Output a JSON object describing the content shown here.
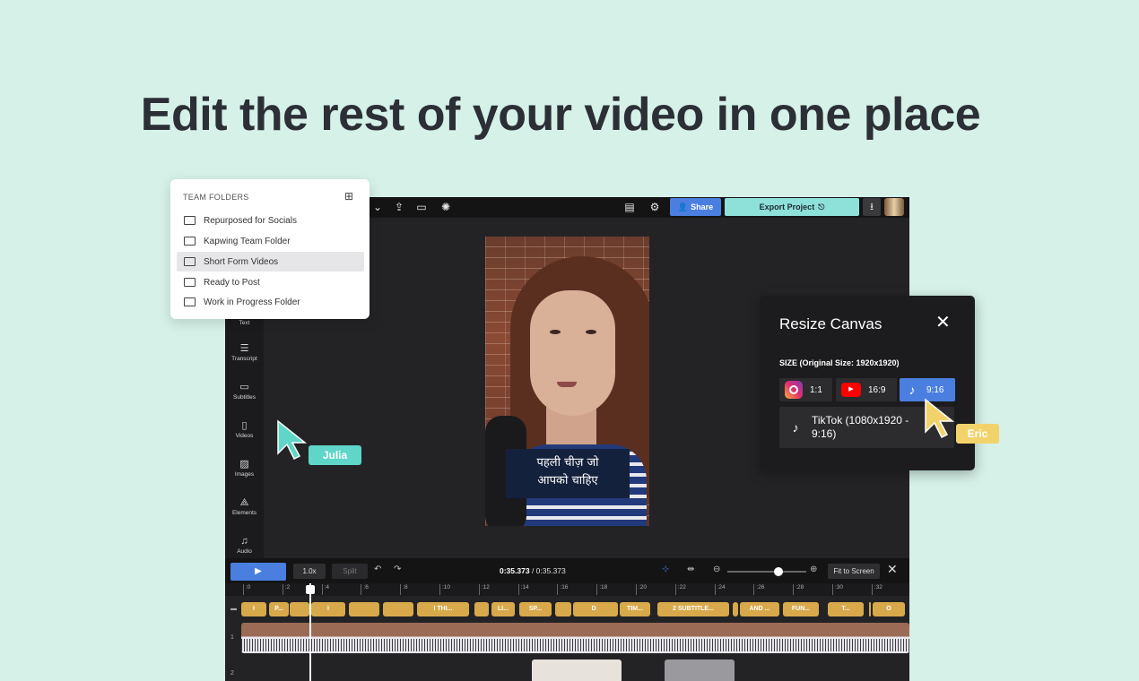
{
  "headline": "Edit the rest of your video in one place",
  "topbar": {
    "share_label": "Share",
    "export_label": "Export Project"
  },
  "sidebar": {
    "items": [
      {
        "label": "Text",
        "icon": "text-icon"
      },
      {
        "label": "Transcript",
        "icon": "transcript-icon"
      },
      {
        "label": "Subtitles",
        "icon": "subtitles-icon"
      },
      {
        "label": "Videos",
        "icon": "videos-icon"
      },
      {
        "label": "Images",
        "icon": "images-icon"
      },
      {
        "label": "Elements",
        "icon": "elements-icon"
      },
      {
        "label": "Audio",
        "icon": "audio-icon"
      }
    ]
  },
  "subtitle": {
    "line1": "पहली चीज़ जो",
    "line2": "आपको चाहिए"
  },
  "timeline": {
    "speed": "1.0x",
    "split": "Split",
    "time_current": "0:35.373",
    "time_total": "/ 0:35.373",
    "fit_label": "Fit to Screen",
    "ticks": [
      ":0",
      ":2",
      ":4",
      ":6",
      ":8",
      ":10",
      ":12",
      ":14",
      ":16",
      ":18",
      ":20",
      ":22",
      ":24",
      ":26",
      ":28",
      ":30",
      ":32"
    ],
    "caption_clips": [
      "I",
      "P...",
      "I",
      "I THI...",
      "LI...",
      "SP...",
      "D",
      "TIM...",
      "2 SUBTITLE...",
      "AND ...",
      "FUN...",
      "T...",
      "O"
    ],
    "rows": [
      "1",
      "2"
    ]
  },
  "team_folders": {
    "title": "TEAM FOLDERS",
    "items": [
      "Repurposed for Socials",
      "Kapwing Team Folder",
      "Short Form Videos",
      "Ready to Post",
      "Work in Progress Folder"
    ],
    "selected_index": 2
  },
  "resize_canvas": {
    "title": "Resize Canvas",
    "size_label": "SIZE (Original Size: 1920x1920)",
    "options": [
      {
        "label": "1:1",
        "icon": "instagram-icon"
      },
      {
        "label": "16:9",
        "icon": "youtube-icon"
      },
      {
        "label": "9:16",
        "icon": "tiktok-icon",
        "active": true
      }
    ],
    "detail_line1": "TikTok (1080x1920 -",
    "detail_line2": "9:16)"
  },
  "cursors": {
    "julia": "Julia",
    "eric": "Eric"
  },
  "colors": {
    "background": "#d5f1e8",
    "accent_blue": "#4a7fe0",
    "export_teal": "#8ee1d8",
    "julia": "#5fd6c7",
    "eric": "#f2d36b"
  }
}
